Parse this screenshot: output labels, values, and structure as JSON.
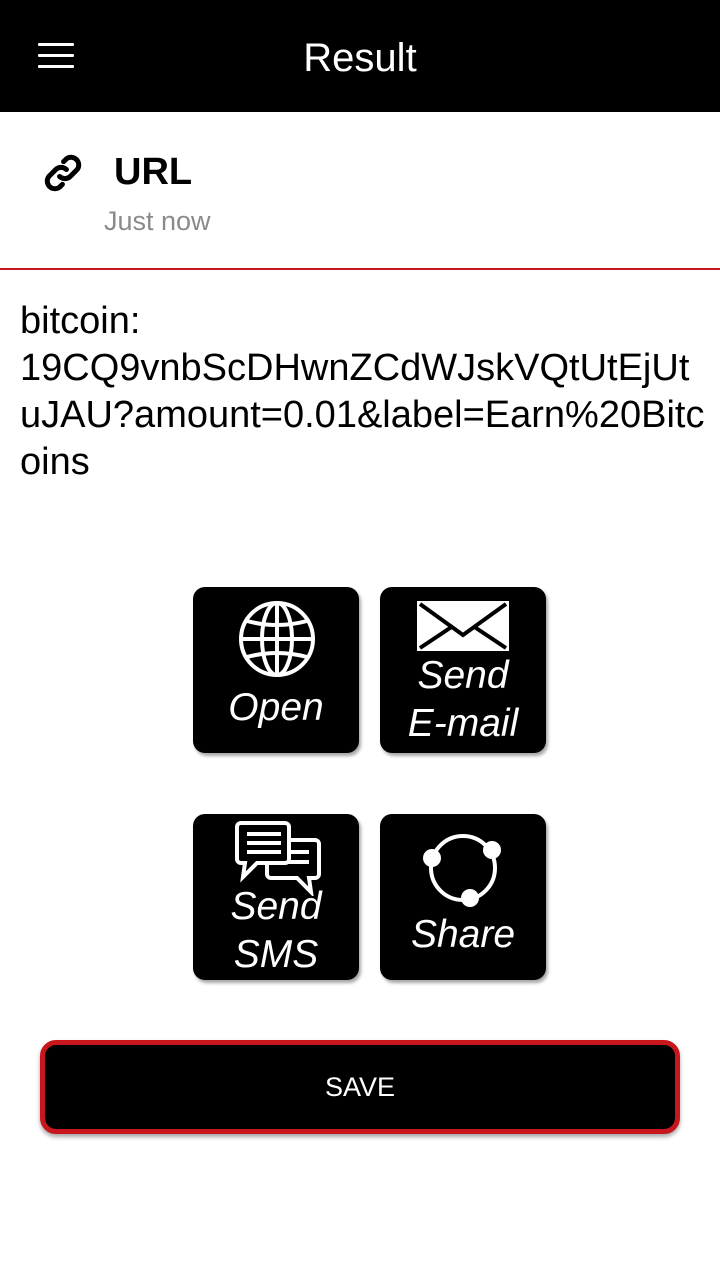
{
  "appbar": {
    "title": "Result",
    "menu_icon": "hamburger-menu-icon"
  },
  "result": {
    "type_icon": "link-icon",
    "type_label": "URL",
    "timestamp": "Just now",
    "content": "bitcoin:\n19CQ9vnbScDHwnZCdWJskVQtUtEjUtuJAU?amount=0.01&label=Earn%20Bitcoins"
  },
  "actions": {
    "open": {
      "label": "Open",
      "icon": "globe-icon"
    },
    "email": {
      "label_line1": "Send",
      "label_line2": "E-mail",
      "icon": "envelope-icon"
    },
    "sms": {
      "label_line1": "Send",
      "label_line2": "SMS",
      "icon": "chat-bubbles-icon"
    },
    "share": {
      "label": "Share",
      "icon": "share-icon"
    }
  },
  "save_button": {
    "label": "SAVE"
  },
  "colors": {
    "appbar_bg": "#000000",
    "accent_red": "#c8161d",
    "timestamp_gray": "#8a8a8a"
  }
}
